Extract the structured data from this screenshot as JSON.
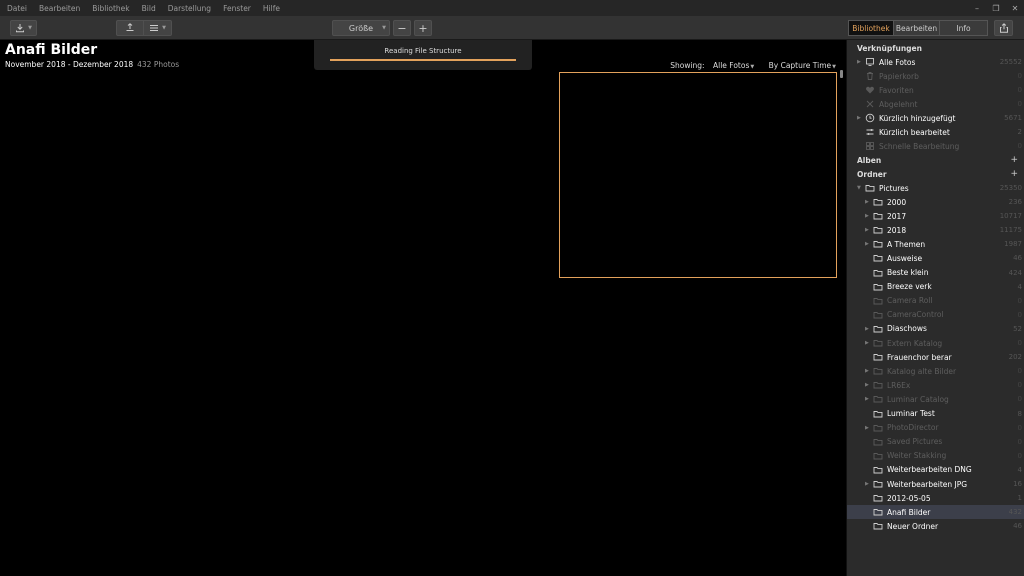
{
  "menu": [
    "Datei",
    "Bearbeiten",
    "Bibliothek",
    "Bild",
    "Darstellung",
    "Fenster",
    "Hilfe"
  ],
  "window_controls": [
    "–",
    "❐",
    "✕"
  ],
  "toolbar": {
    "import_icon": "download-icon",
    "upload_icon": "upload-icon",
    "list_icon": "list-icon",
    "size_label": "Größe",
    "zoom_out": "−",
    "zoom_in": "+",
    "share_icon": "share-icon"
  },
  "tabs": [
    {
      "label": "Bibliothek",
      "active": true
    },
    {
      "label": "Bearbeiten",
      "active": false
    },
    {
      "label": "Info",
      "active": false
    }
  ],
  "main": {
    "title": "Anafi Bilder",
    "date_range": "November 2018 - Dezember 2018",
    "photo_count": "432 Photos",
    "showing_label": "Showing:",
    "showing_value": "Alle Fotos",
    "sort_value": "By Capture Time"
  },
  "progress": {
    "text": "Reading File Structure",
    "fraction": 1.0
  },
  "colors": {
    "accent": "#e3a25c",
    "selection": "#3c3f4a"
  },
  "sidebar": {
    "shortcuts_title": "Verknüpfungen",
    "shortcuts": [
      {
        "label": "Alle Fotos",
        "count": "25552",
        "icon": "photos-icon",
        "dim": false,
        "expander": true
      },
      {
        "label": "Papierkorb",
        "count": "0",
        "icon": "trash-icon",
        "dim": true,
        "expander": false
      },
      {
        "label": "Favoriten",
        "count": "0",
        "icon": "heart-icon",
        "dim": true,
        "expander": false
      },
      {
        "label": "Abgelehnt",
        "count": "0",
        "icon": "x-icon",
        "dim": true,
        "expander": false
      },
      {
        "label": "Kürzlich hinzugefügt",
        "count": "5671",
        "icon": "clock-add-icon",
        "dim": false,
        "expander": true
      },
      {
        "label": "Kürzlich bearbeitet",
        "count": "2",
        "icon": "sliders-icon",
        "dim": false,
        "expander": false
      },
      {
        "label": "Schnelle Bearbeitung",
        "count": "0",
        "icon": "grid-icon",
        "dim": true,
        "expander": false
      }
    ],
    "albums_title": "Alben",
    "folders_title": "Ordner",
    "root_folder": {
      "label": "Pictures",
      "count": "25350"
    },
    "folders": [
      {
        "label": "2000",
        "count": "236",
        "dim": false,
        "expander": true,
        "selected": false
      },
      {
        "label": "2017",
        "count": "10717",
        "dim": false,
        "expander": true,
        "selected": false
      },
      {
        "label": "2018",
        "count": "11175",
        "dim": false,
        "expander": true,
        "selected": false
      },
      {
        "label": "A Themen",
        "count": "1987",
        "dim": false,
        "expander": true,
        "selected": false
      },
      {
        "label": "Ausweise",
        "count": "46",
        "dim": false,
        "expander": false,
        "selected": false
      },
      {
        "label": "Beste klein",
        "count": "424",
        "dim": false,
        "expander": false,
        "selected": false
      },
      {
        "label": "Breeze verk",
        "count": "4",
        "dim": false,
        "expander": false,
        "selected": false
      },
      {
        "label": "Camera Roll",
        "count": "0",
        "dim": true,
        "expander": false,
        "selected": false
      },
      {
        "label": "CameraControl",
        "count": "0",
        "dim": true,
        "expander": false,
        "selected": false
      },
      {
        "label": "Diaschows",
        "count": "52",
        "dim": false,
        "expander": true,
        "selected": false
      },
      {
        "label": "Extern Katalog",
        "count": "0",
        "dim": true,
        "expander": true,
        "selected": false
      },
      {
        "label": "Frauenchor berar",
        "count": "202",
        "dim": false,
        "expander": false,
        "selected": false
      },
      {
        "label": "Katalog alte Bilder",
        "count": "0",
        "dim": true,
        "expander": true,
        "selected": false
      },
      {
        "label": "LR6Ex",
        "count": "0",
        "dim": true,
        "expander": true,
        "selected": false
      },
      {
        "label": "Luminar Catalog",
        "count": "0",
        "dim": true,
        "expander": true,
        "selected": false
      },
      {
        "label": "Luminar Test",
        "count": "8",
        "dim": false,
        "expander": false,
        "selected": false
      },
      {
        "label": "PhotoDirector",
        "count": "0",
        "dim": true,
        "expander": true,
        "selected": false
      },
      {
        "label": "Saved Pictures",
        "count": "0",
        "dim": true,
        "expander": false,
        "selected": false
      },
      {
        "label": "Weiter Stakking",
        "count": "0",
        "dim": true,
        "expander": false,
        "selected": false
      },
      {
        "label": "Weiterbearbeiten DNG",
        "count": "4",
        "dim": false,
        "expander": false,
        "selected": false
      },
      {
        "label": "Weiterbearbeiten JPG",
        "count": "16",
        "dim": false,
        "expander": true,
        "selected": false
      },
      {
        "label": "2012-05-05",
        "count": "1",
        "dim": false,
        "expander": false,
        "selected": false
      },
      {
        "label": "Anafi Bilder",
        "count": "432",
        "dim": false,
        "expander": false,
        "selected": true
      },
      {
        "label": "Neuer Ordner",
        "count": "46",
        "dim": false,
        "expander": false,
        "selected": false
      }
    ]
  }
}
